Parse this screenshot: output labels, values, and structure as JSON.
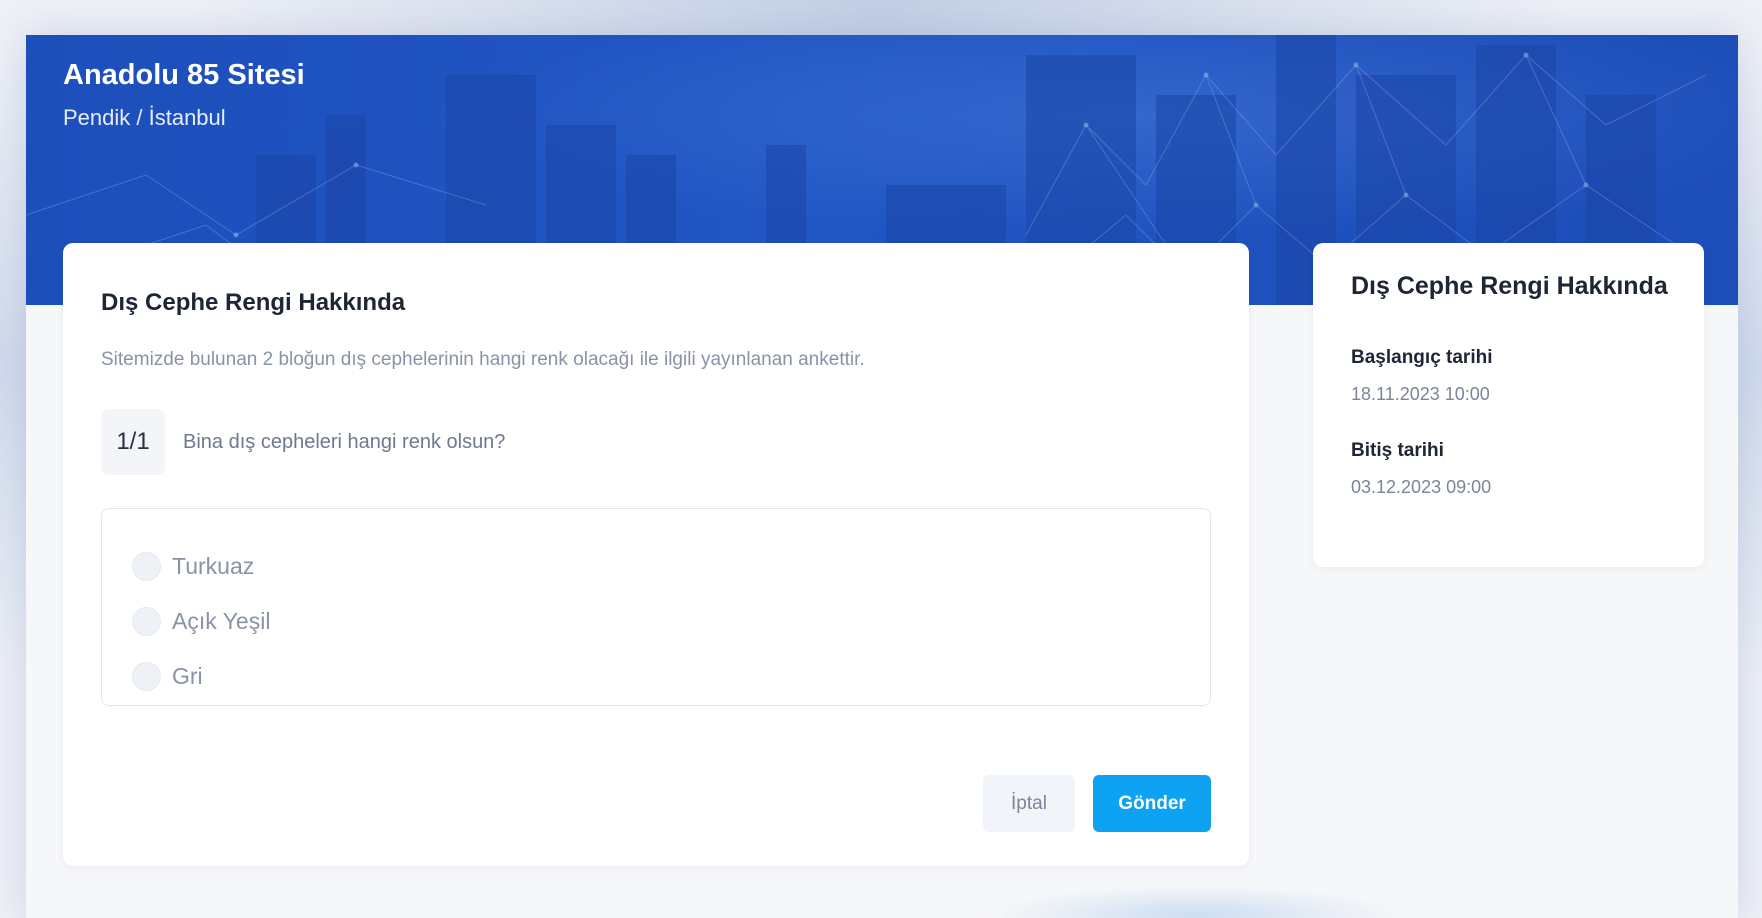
{
  "hero": {
    "title": "Anadolu 85 Sitesi",
    "subtitle": "Pendik / İstanbul"
  },
  "survey": {
    "title": "Dış Cephe Rengi Hakkında",
    "description": "Sitemizde bulunan 2 bloğun dış cephelerinin hangi renk olacağı ile ilgili yayınlanan ankettir.",
    "question_number": "1/1",
    "question_text": "Bina dış cepheleri hangi renk olsun?",
    "options": [
      {
        "label": "Turkuaz"
      },
      {
        "label": "Açık Yeşil"
      },
      {
        "label": "Gri"
      }
    ],
    "cancel_label": "İptal",
    "submit_label": "Gönder"
  },
  "info": {
    "title": "Dış Cephe Rengi Hakkında",
    "start_label": "Başlangıç tarihi",
    "start_value": "18.11.2023 10:00",
    "end_label": "Bitiş tarihi",
    "end_value": "03.12.2023 09:00"
  },
  "colors": {
    "hero_blue": "#2156c4",
    "primary_button": "#0ea2f2",
    "muted_text": "#8a92a6"
  }
}
